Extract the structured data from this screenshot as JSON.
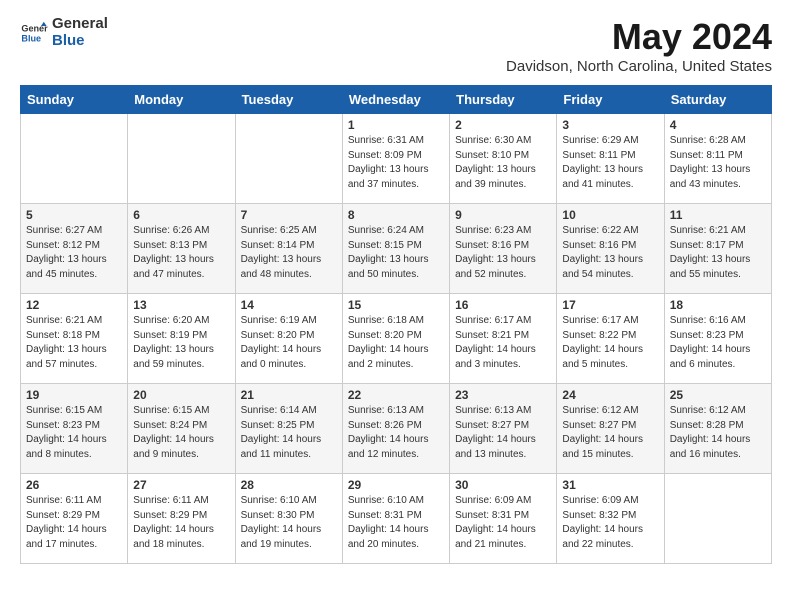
{
  "logo": {
    "general": "General",
    "blue": "Blue"
  },
  "title": "May 2024",
  "location": "Davidson, North Carolina, United States",
  "weekdays": [
    "Sunday",
    "Monday",
    "Tuesday",
    "Wednesday",
    "Thursday",
    "Friday",
    "Saturday"
  ],
  "weeks": [
    [
      {
        "day": "",
        "info": ""
      },
      {
        "day": "",
        "info": ""
      },
      {
        "day": "",
        "info": ""
      },
      {
        "day": "1",
        "info": "Sunrise: 6:31 AM\nSunset: 8:09 PM\nDaylight: 13 hours\nand 37 minutes."
      },
      {
        "day": "2",
        "info": "Sunrise: 6:30 AM\nSunset: 8:10 PM\nDaylight: 13 hours\nand 39 minutes."
      },
      {
        "day": "3",
        "info": "Sunrise: 6:29 AM\nSunset: 8:11 PM\nDaylight: 13 hours\nand 41 minutes."
      },
      {
        "day": "4",
        "info": "Sunrise: 6:28 AM\nSunset: 8:11 PM\nDaylight: 13 hours\nand 43 minutes."
      }
    ],
    [
      {
        "day": "5",
        "info": "Sunrise: 6:27 AM\nSunset: 8:12 PM\nDaylight: 13 hours\nand 45 minutes."
      },
      {
        "day": "6",
        "info": "Sunrise: 6:26 AM\nSunset: 8:13 PM\nDaylight: 13 hours\nand 47 minutes."
      },
      {
        "day": "7",
        "info": "Sunrise: 6:25 AM\nSunset: 8:14 PM\nDaylight: 13 hours\nand 48 minutes."
      },
      {
        "day": "8",
        "info": "Sunrise: 6:24 AM\nSunset: 8:15 PM\nDaylight: 13 hours\nand 50 minutes."
      },
      {
        "day": "9",
        "info": "Sunrise: 6:23 AM\nSunset: 8:16 PM\nDaylight: 13 hours\nand 52 minutes."
      },
      {
        "day": "10",
        "info": "Sunrise: 6:22 AM\nSunset: 8:16 PM\nDaylight: 13 hours\nand 54 minutes."
      },
      {
        "day": "11",
        "info": "Sunrise: 6:21 AM\nSunset: 8:17 PM\nDaylight: 13 hours\nand 55 minutes."
      }
    ],
    [
      {
        "day": "12",
        "info": "Sunrise: 6:21 AM\nSunset: 8:18 PM\nDaylight: 13 hours\nand 57 minutes."
      },
      {
        "day": "13",
        "info": "Sunrise: 6:20 AM\nSunset: 8:19 PM\nDaylight: 13 hours\nand 59 minutes."
      },
      {
        "day": "14",
        "info": "Sunrise: 6:19 AM\nSunset: 8:20 PM\nDaylight: 14 hours\nand 0 minutes."
      },
      {
        "day": "15",
        "info": "Sunrise: 6:18 AM\nSunset: 8:20 PM\nDaylight: 14 hours\nand 2 minutes."
      },
      {
        "day": "16",
        "info": "Sunrise: 6:17 AM\nSunset: 8:21 PM\nDaylight: 14 hours\nand 3 minutes."
      },
      {
        "day": "17",
        "info": "Sunrise: 6:17 AM\nSunset: 8:22 PM\nDaylight: 14 hours\nand 5 minutes."
      },
      {
        "day": "18",
        "info": "Sunrise: 6:16 AM\nSunset: 8:23 PM\nDaylight: 14 hours\nand 6 minutes."
      }
    ],
    [
      {
        "day": "19",
        "info": "Sunrise: 6:15 AM\nSunset: 8:23 PM\nDaylight: 14 hours\nand 8 minutes."
      },
      {
        "day": "20",
        "info": "Sunrise: 6:15 AM\nSunset: 8:24 PM\nDaylight: 14 hours\nand 9 minutes."
      },
      {
        "day": "21",
        "info": "Sunrise: 6:14 AM\nSunset: 8:25 PM\nDaylight: 14 hours\nand 11 minutes."
      },
      {
        "day": "22",
        "info": "Sunrise: 6:13 AM\nSunset: 8:26 PM\nDaylight: 14 hours\nand 12 minutes."
      },
      {
        "day": "23",
        "info": "Sunrise: 6:13 AM\nSunset: 8:27 PM\nDaylight: 14 hours\nand 13 minutes."
      },
      {
        "day": "24",
        "info": "Sunrise: 6:12 AM\nSunset: 8:27 PM\nDaylight: 14 hours\nand 15 minutes."
      },
      {
        "day": "25",
        "info": "Sunrise: 6:12 AM\nSunset: 8:28 PM\nDaylight: 14 hours\nand 16 minutes."
      }
    ],
    [
      {
        "day": "26",
        "info": "Sunrise: 6:11 AM\nSunset: 8:29 PM\nDaylight: 14 hours\nand 17 minutes."
      },
      {
        "day": "27",
        "info": "Sunrise: 6:11 AM\nSunset: 8:29 PM\nDaylight: 14 hours\nand 18 minutes."
      },
      {
        "day": "28",
        "info": "Sunrise: 6:10 AM\nSunset: 8:30 PM\nDaylight: 14 hours\nand 19 minutes."
      },
      {
        "day": "29",
        "info": "Sunrise: 6:10 AM\nSunset: 8:31 PM\nDaylight: 14 hours\nand 20 minutes."
      },
      {
        "day": "30",
        "info": "Sunrise: 6:09 AM\nSunset: 8:31 PM\nDaylight: 14 hours\nand 21 minutes."
      },
      {
        "day": "31",
        "info": "Sunrise: 6:09 AM\nSunset: 8:32 PM\nDaylight: 14 hours\nand 22 minutes."
      },
      {
        "day": "",
        "info": ""
      }
    ]
  ]
}
